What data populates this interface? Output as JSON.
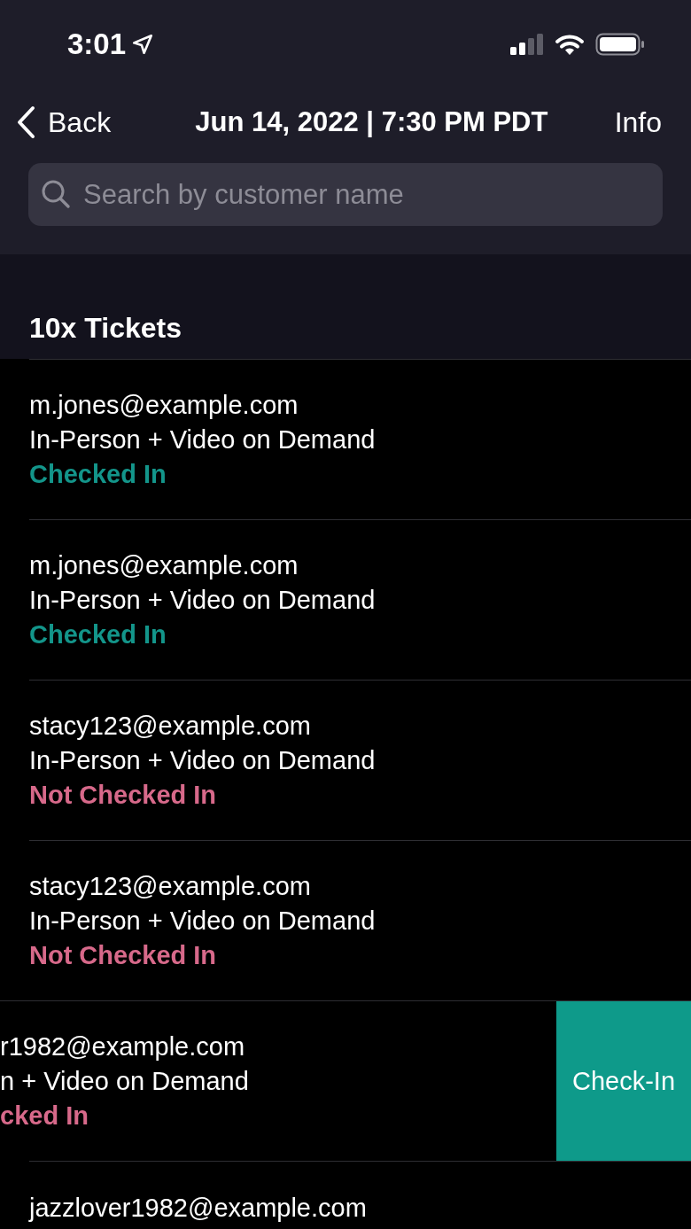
{
  "status_bar": {
    "time": "3:01"
  },
  "nav": {
    "back": "Back",
    "title": "Jun 14, 2022 | 7:30 PM PDT",
    "info": "Info"
  },
  "search": {
    "placeholder": "Search by customer name"
  },
  "section": {
    "title": "10x Tickets"
  },
  "tickets": [
    {
      "kind": "normal",
      "email": "m.jones@example.com",
      "ticket_type": "In-Person + Video on Demand",
      "status": "Checked In",
      "checked_in": true
    },
    {
      "kind": "normal",
      "email": "m.jones@example.com",
      "ticket_type": "In-Person + Video on Demand",
      "status": "Checked In",
      "checked_in": true
    },
    {
      "kind": "normal",
      "email": "stacy123@example.com",
      "ticket_type": "In-Person + Video on Demand",
      "status": "Not Checked In",
      "checked_in": false
    },
    {
      "kind": "normal",
      "email": "stacy123@example.com",
      "ticket_type": "In-Person + Video on Demand",
      "status": "Not Checked In",
      "checked_in": false
    },
    {
      "kind": "swiped",
      "email": "r1982@example.com",
      "ticket_type": "n + Video on Demand",
      "status": "cked In",
      "checked_in": false,
      "action": "Check-In"
    },
    {
      "kind": "partial",
      "email": "jazzlover1982@example.com"
    }
  ]
}
